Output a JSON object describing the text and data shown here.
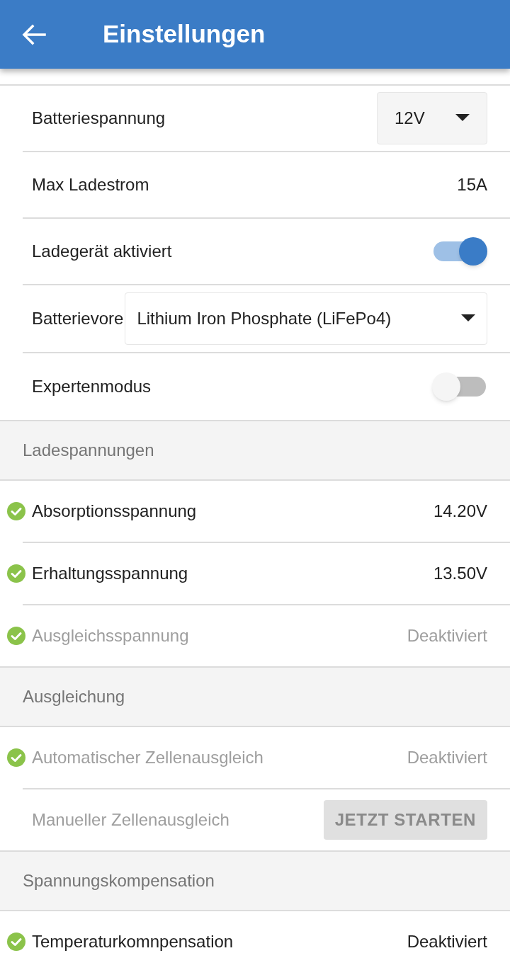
{
  "header": {
    "title": "Einstellungen"
  },
  "settings": [
    {
      "kind": "dropdown",
      "label": "Batteriespannung",
      "value": "12V"
    },
    {
      "kind": "value",
      "label": "Max Ladestrom",
      "value": "15A"
    },
    {
      "kind": "toggle",
      "label": "Ladegerät aktiviert",
      "on": true
    },
    {
      "kind": "wide_dropdown",
      "label": "Batterievore",
      "value": "Lithium Iron Phosphate (LiFePo4)"
    },
    {
      "kind": "toggle",
      "label": "Expertenmodus",
      "on": false
    }
  ],
  "groups": [
    {
      "title": "Ladespannungen",
      "items": [
        {
          "kind": "value",
          "label": "Absorptionsspannung",
          "value": "14.20V",
          "checked": true,
          "disabled": false
        },
        {
          "kind": "value",
          "label": "Erhaltungsspannung",
          "value": "13.50V",
          "checked": true,
          "disabled": false
        },
        {
          "kind": "value",
          "label": "Ausgleichsspannung",
          "value": "Deaktiviert",
          "checked": true,
          "disabled": true
        }
      ]
    },
    {
      "title": "Ausgleichung",
      "items": [
        {
          "kind": "value",
          "label": "Automatischer Zellenausgleich",
          "value": "Deaktiviert",
          "checked": true,
          "disabled": true
        },
        {
          "kind": "button",
          "label": "Manueller Zellenausgleich",
          "value": "JETZT STARTEN",
          "checked": false,
          "disabled": true
        }
      ]
    },
    {
      "title": "Spannungskompensation",
      "items": [
        {
          "kind": "value",
          "label": "Temperaturkomnpensation",
          "value": "Deaktiviert",
          "checked": true,
          "disabled": false
        }
      ]
    }
  ]
}
